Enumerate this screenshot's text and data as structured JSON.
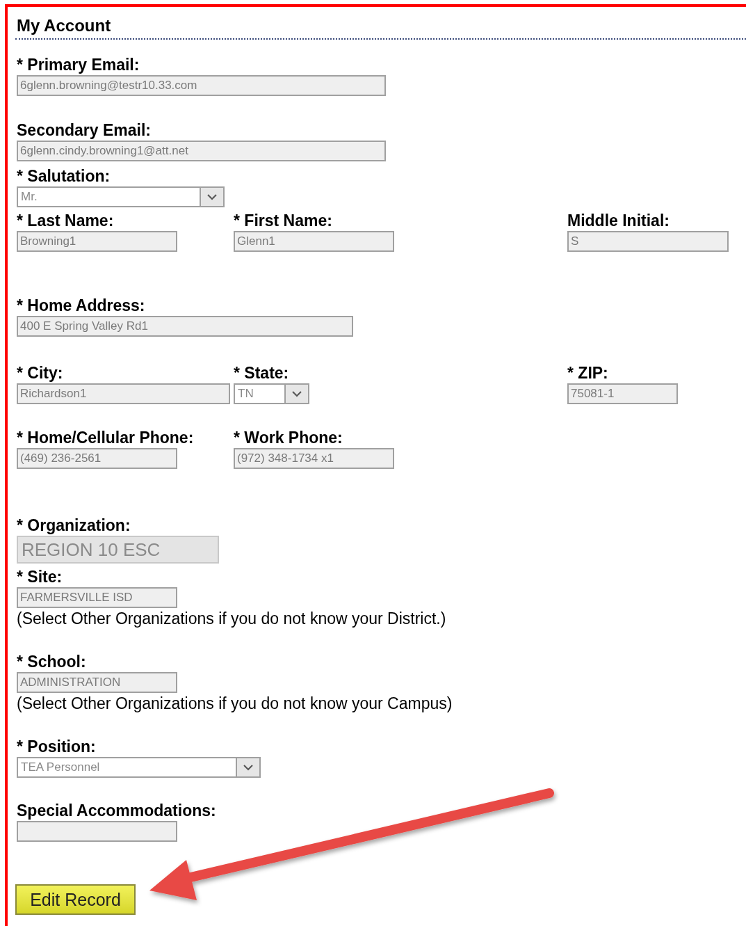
{
  "title": "My Account",
  "rows": [
    [
      {
        "label": "* Primary Email:",
        "kind": "text",
        "value": "6glenn.browning@testr10.33.com"
      }
    ],
    [
      {
        "label": "Secondary Email:",
        "kind": "text",
        "value": "6glenn.cindy.browning1@att.net"
      }
    ],
    [
      {
        "label": "*  Salutation:",
        "kind": "select",
        "value": "Mr."
      }
    ],
    [
      {
        "label": "* Last Name:",
        "kind": "text",
        "value": "Browning1"
      },
      {
        "label": "* First Name:",
        "kind": "text",
        "value": "Glenn1"
      },
      {
        "label": "Middle Initial:",
        "kind": "text",
        "value": "S"
      }
    ],
    [
      {
        "label": "* Home Address:",
        "kind": "text",
        "value": "400 E Spring Valley Rd1"
      }
    ],
    [
      {
        "label": "* City:",
        "kind": "text",
        "value": "Richardson1"
      },
      {
        "label": "* State:",
        "kind": "select",
        "value": "TN"
      },
      {
        "label": "* ZIP:",
        "kind": "text",
        "value": "75081-1"
      }
    ],
    [
      {
        "label": "* Home/Cellular Phone:",
        "kind": "text",
        "value": "(469) 236-2561"
      },
      {
        "label": "* Work Phone:",
        "kind": "text",
        "value": "(972) 348-1734 x1"
      }
    ],
    [
      {
        "label": "* Organization:",
        "kind": "large",
        "value": "REGION 10 ESC"
      }
    ],
    [
      {
        "label": "* Site:",
        "kind": "text",
        "value": "FARMERSVILLE ISD",
        "note": "(Select Other Organizations if you do not know your District.)"
      }
    ],
    [
      {
        "label": "* School:",
        "kind": "text",
        "value": "ADMINISTRATION",
        "note": "(Select Other Organizations if you do not know your Campus)"
      }
    ],
    [
      {
        "label": "* Position:",
        "kind": "select",
        "value": "TEA Personnel"
      }
    ],
    [
      {
        "label": "Special Accommodations:",
        "kind": "text"
      }
    ]
  ],
  "button": "Edit Record"
}
